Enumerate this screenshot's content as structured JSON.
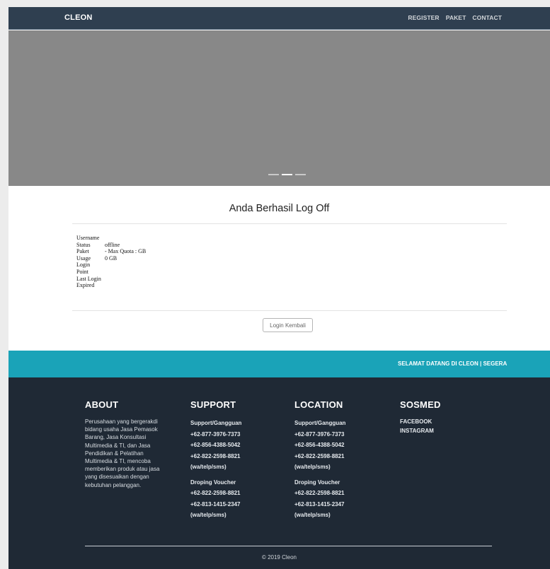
{
  "navbar": {
    "brand": "CLEON",
    "links": [
      "REGISTER",
      "PAKET",
      "CONTACT"
    ]
  },
  "hero": {
    "background": "#888888",
    "slides": 3,
    "active_slide": 2
  },
  "content": {
    "title": "Anda Berhasil Log Off",
    "info": {
      "username_label": "Username",
      "username_value": "",
      "status_label": "Status",
      "status_value": "offline",
      "paket_label": "Paket",
      "paket_value": "- Max Quota : GB",
      "usage_label": "Usage",
      "usage_value": "0 GB",
      "login_label": "Login",
      "login_value": "",
      "point_label": "Point",
      "point_value": "",
      "last_login_label": "Last Login",
      "last_login_value": "",
      "expired_label": "Expired",
      "expired_value": ""
    },
    "login_button": "Login Kembali"
  },
  "marquee": {
    "text": "SELAMAT DATANG DI CLEON | SEGERA",
    "color": "#1aa3b8"
  },
  "footer": {
    "about": {
      "heading": "ABOUT",
      "text": "Perusahaan yang bergerakdi bidang usaha Jasa Pemasok Barang, Jasa Konsultasi Multimedia & TI, dan Jasa Pendidikan & Pelatihan Multimedia & TI, mencoba memberikan produk atau jasa yang disesuaikan dengan kebutuhan pelanggan."
    },
    "support": {
      "heading": "SUPPORT",
      "group1": [
        "Support/Gangguan",
        "+62-877-3976-7373",
        "+62-856-4388-5042",
        "+62-822-2598-8821",
        "(wa/telp/sms)"
      ],
      "group2": [
        "Droping Voucher",
        "+62-822-2598-8821",
        "+62-813-1415-2347",
        "(wa/telp/sms)"
      ]
    },
    "location": {
      "heading": "LOCATION",
      "group1": [
        "Support/Gangguan",
        "+62-877-3976-7373",
        "+62-856-4388-5042",
        "+62-822-2598-8821",
        "(wa/telp/sms)"
      ],
      "group2": [
        "Droping Voucher",
        "+62-822-2598-8821",
        "+62-813-1415-2347",
        "(wa/telp/sms)"
      ]
    },
    "sosmed": {
      "heading": "SOSMED",
      "links": [
        "FACEBOOK",
        "INSTAGRAM"
      ]
    },
    "copyright": "© 2019 Cleon"
  }
}
